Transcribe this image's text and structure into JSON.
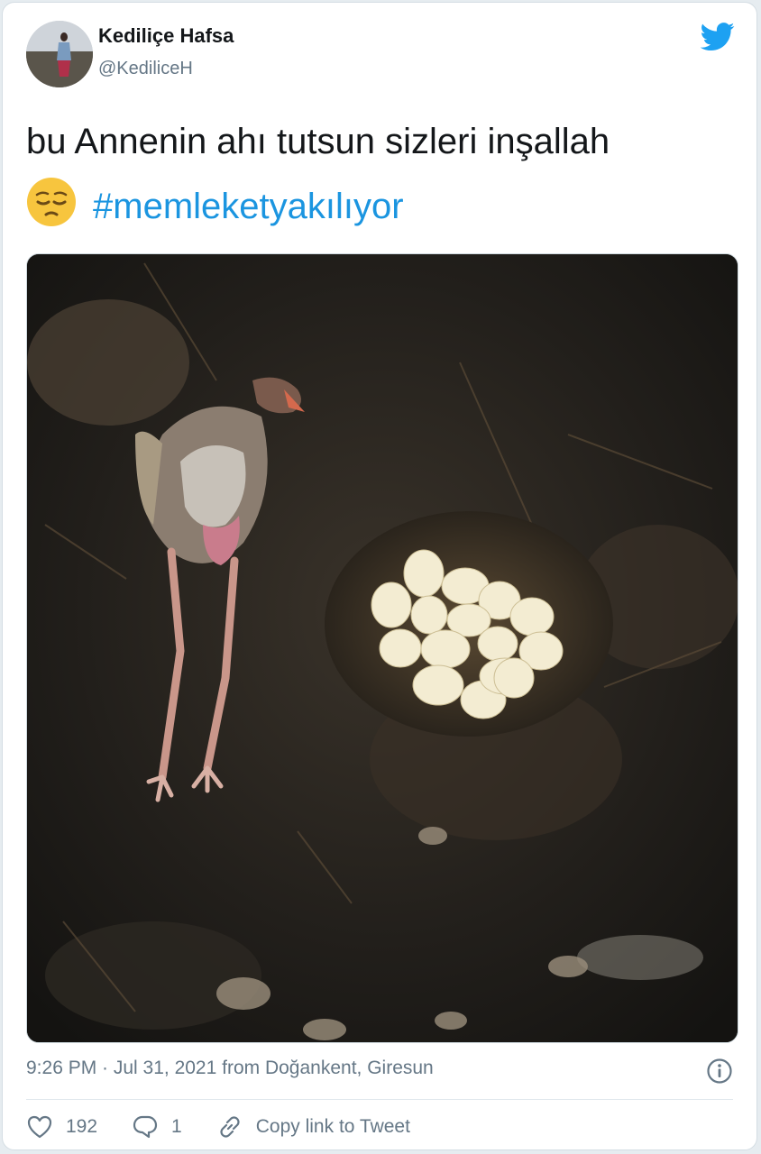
{
  "author": {
    "display_name": "Kediliçe Hafsa",
    "handle": "@KediliceH"
  },
  "tweet": {
    "line1": "bu Annenin ahı tutsun sizleri inşallah",
    "emoji": "pensive-face",
    "hashtag": "#memleketyakılıyor"
  },
  "meta": {
    "timestamp": "9:26 PM · Jul 31, 2021 from Doğankent, Giresun"
  },
  "actions": {
    "likes": "192",
    "replies": "1",
    "copy_link_label": "Copy link to Tweet"
  },
  "colors": {
    "twitter_blue": "#1da1f2",
    "hashtag": "#1b95e0",
    "secondary_text": "#657786",
    "primary_text": "#14171a"
  },
  "icons": [
    "twitter-bird-icon",
    "info-icon",
    "heart-icon",
    "reply-icon",
    "link-icon"
  ]
}
